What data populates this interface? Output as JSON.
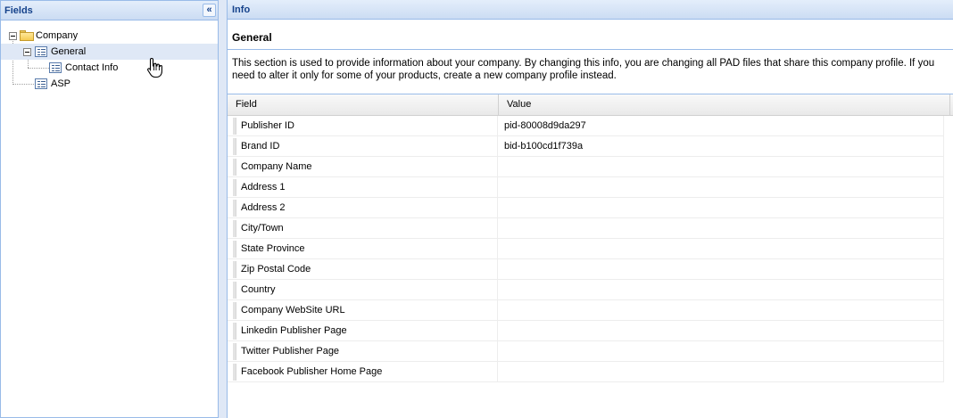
{
  "left_panel": {
    "title": "Fields",
    "collapse_icon": "double-chevron-left-icon",
    "tree": {
      "company": "Company",
      "general": "General",
      "contact_info": "Contact Info",
      "asp": "ASP"
    }
  },
  "right_panel": {
    "title": "Info",
    "section_title": "General",
    "description": "This section is used to provide information about your company. By changing this info, you are changing all PAD files that share this company profile. If you need to alter it only for some of your products, create a new company profile instead.",
    "grid": {
      "columns": [
        "Field",
        "Value"
      ],
      "rows": [
        {
          "field": "Publisher ID",
          "value": "pid-80008d9da297"
        },
        {
          "field": "Brand ID",
          "value": "bid-b100cd1f739a"
        },
        {
          "field": "Company Name",
          "value": ""
        },
        {
          "field": "Address 1",
          "value": ""
        },
        {
          "field": "Address 2",
          "value": ""
        },
        {
          "field": "City/Town",
          "value": ""
        },
        {
          "field": "State Province",
          "value": ""
        },
        {
          "field": "Zip Postal Code",
          "value": ""
        },
        {
          "field": "Country",
          "value": ""
        },
        {
          "field": "Company WebSite URL",
          "value": ""
        },
        {
          "field": "Linkedin Publisher Page",
          "value": ""
        },
        {
          "field": "Twitter Publisher Page",
          "value": ""
        },
        {
          "field": "Facebook Publisher Home Page",
          "value": ""
        }
      ]
    }
  },
  "colors": {
    "header_text": "#15428b",
    "border": "#99bbe8",
    "selected_row": "#dfe8f6"
  }
}
